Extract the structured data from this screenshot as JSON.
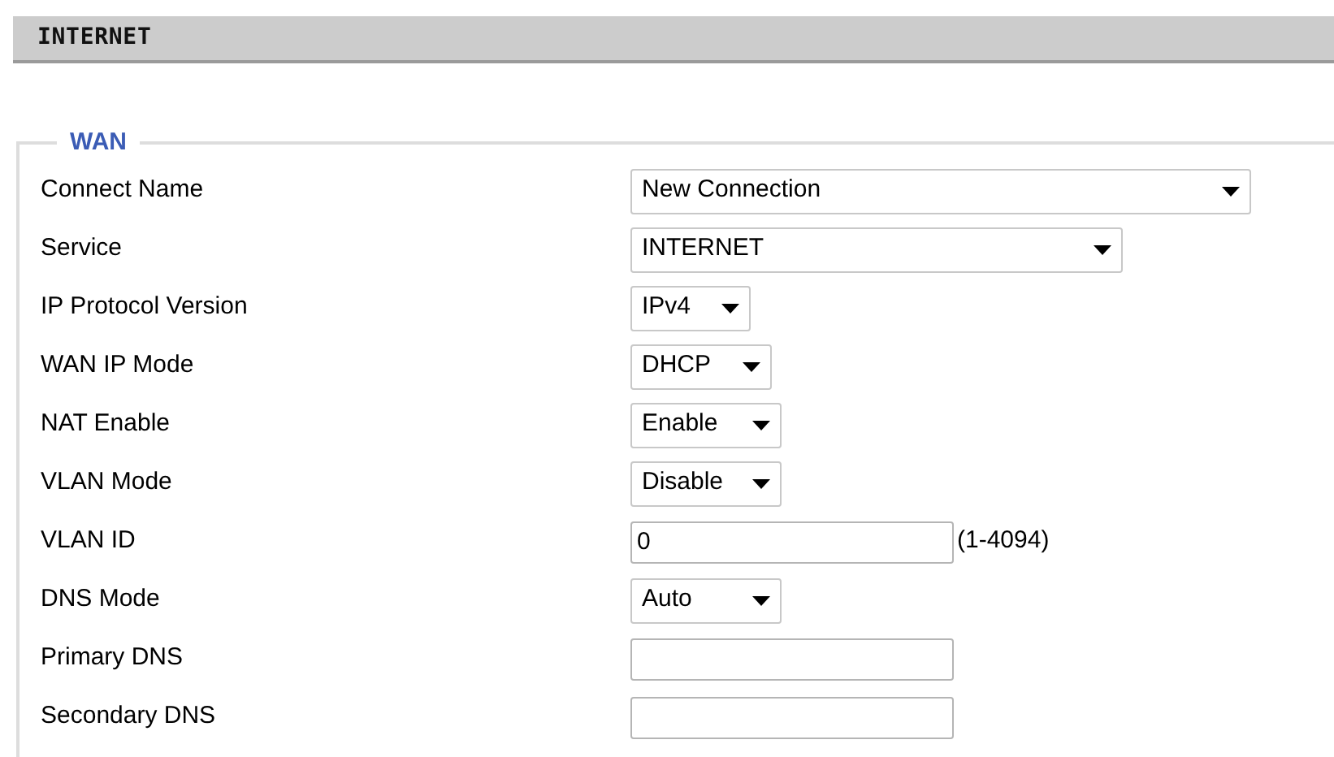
{
  "header": {
    "title": "INTERNET"
  },
  "section": {
    "legend": "WAN",
    "rows": [
      {
        "label": "Connect Name",
        "kind": "select",
        "value": "New Connection"
      },
      {
        "label": "Service",
        "kind": "select",
        "value": "INTERNET"
      },
      {
        "label": "IP Protocol Version",
        "kind": "select",
        "value": "IPv4"
      },
      {
        "label": "WAN IP Mode",
        "kind": "select",
        "value": "DHCP"
      },
      {
        "label": "NAT Enable",
        "kind": "select",
        "value": "Enable"
      },
      {
        "label": "VLAN Mode",
        "kind": "select",
        "value": "Disable"
      },
      {
        "label": "VLAN ID",
        "kind": "input",
        "value": "0",
        "hint": "(1-4094)"
      },
      {
        "label": "DNS Mode",
        "kind": "select",
        "value": "Auto"
      },
      {
        "label": "Primary DNS",
        "kind": "input",
        "value": ""
      },
      {
        "label": "Secondary DNS",
        "kind": "input",
        "value": ""
      }
    ]
  }
}
